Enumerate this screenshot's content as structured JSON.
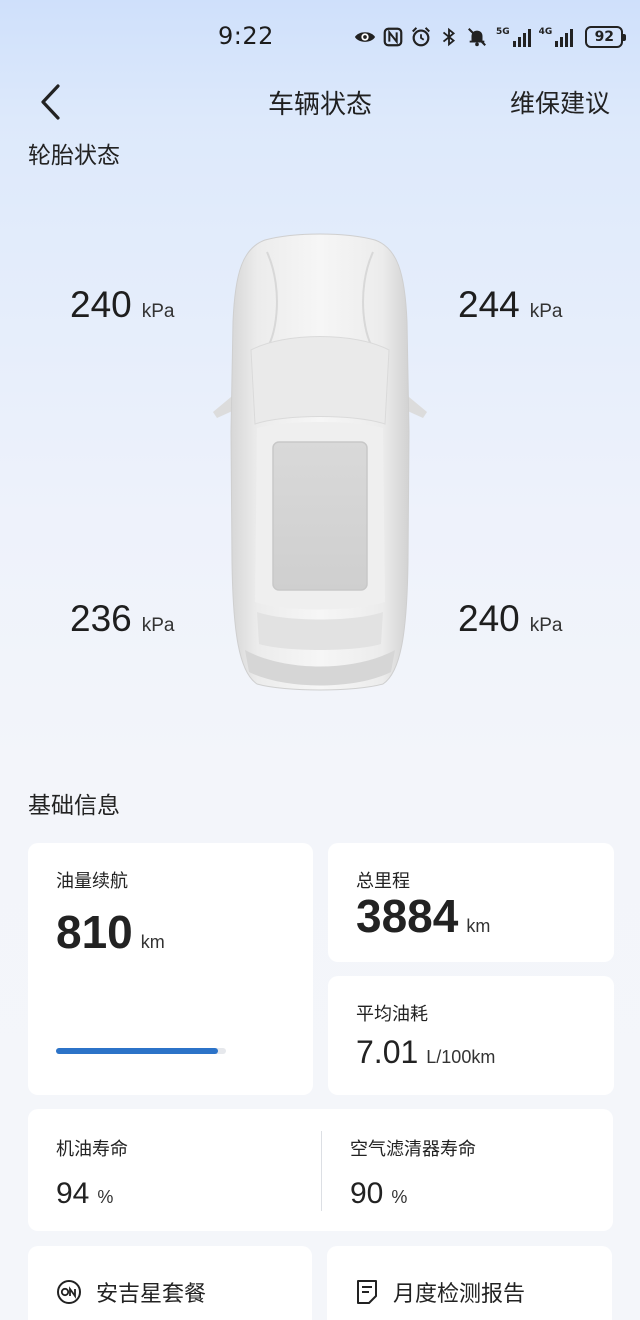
{
  "status_bar": {
    "time": "9:22",
    "net_5g": "5G",
    "net_4g": "4G",
    "battery": "92",
    "icons": [
      "eye-icon",
      "nfc-icon",
      "alarm-icon",
      "bluetooth-icon",
      "bell-off-icon"
    ]
  },
  "header": {
    "title": "车辆状态",
    "right_link": "维保建议",
    "back_icon": "chevron-left-icon"
  },
  "tire_section": {
    "title": "轮胎状态",
    "front_left": {
      "value": "240",
      "unit": "kPa"
    },
    "front_right": {
      "value": "244",
      "unit": "kPa"
    },
    "rear_left": {
      "value": "236",
      "unit": "kPa"
    },
    "rear_right": {
      "value": "240",
      "unit": "kPa"
    }
  },
  "basic_info": {
    "title": "基础信息",
    "range": {
      "label": "油量续航",
      "value": "810",
      "unit": "km",
      "fuel_level_fraction": 0.95
    },
    "odometer": {
      "label": "总里程",
      "value": "3884",
      "unit": "km"
    },
    "avg_fuel": {
      "label": "平均油耗",
      "value": "7.01",
      "unit": "L/100km"
    },
    "oil_life": {
      "label": "机油寿命",
      "value": "94",
      "unit": "%"
    },
    "air_filter_life": {
      "label": "空气滤清器寿命",
      "value": "90",
      "unit": "%"
    }
  },
  "bottom_links": {
    "package": {
      "label": "安吉星套餐",
      "icon": "onstar-icon"
    },
    "report": {
      "label": "月度检测报告",
      "icon": "document-icon"
    }
  },
  "colors": {
    "accent": "#2c73c8",
    "background_top": "#cfe0fb",
    "card": "#ffffff"
  }
}
